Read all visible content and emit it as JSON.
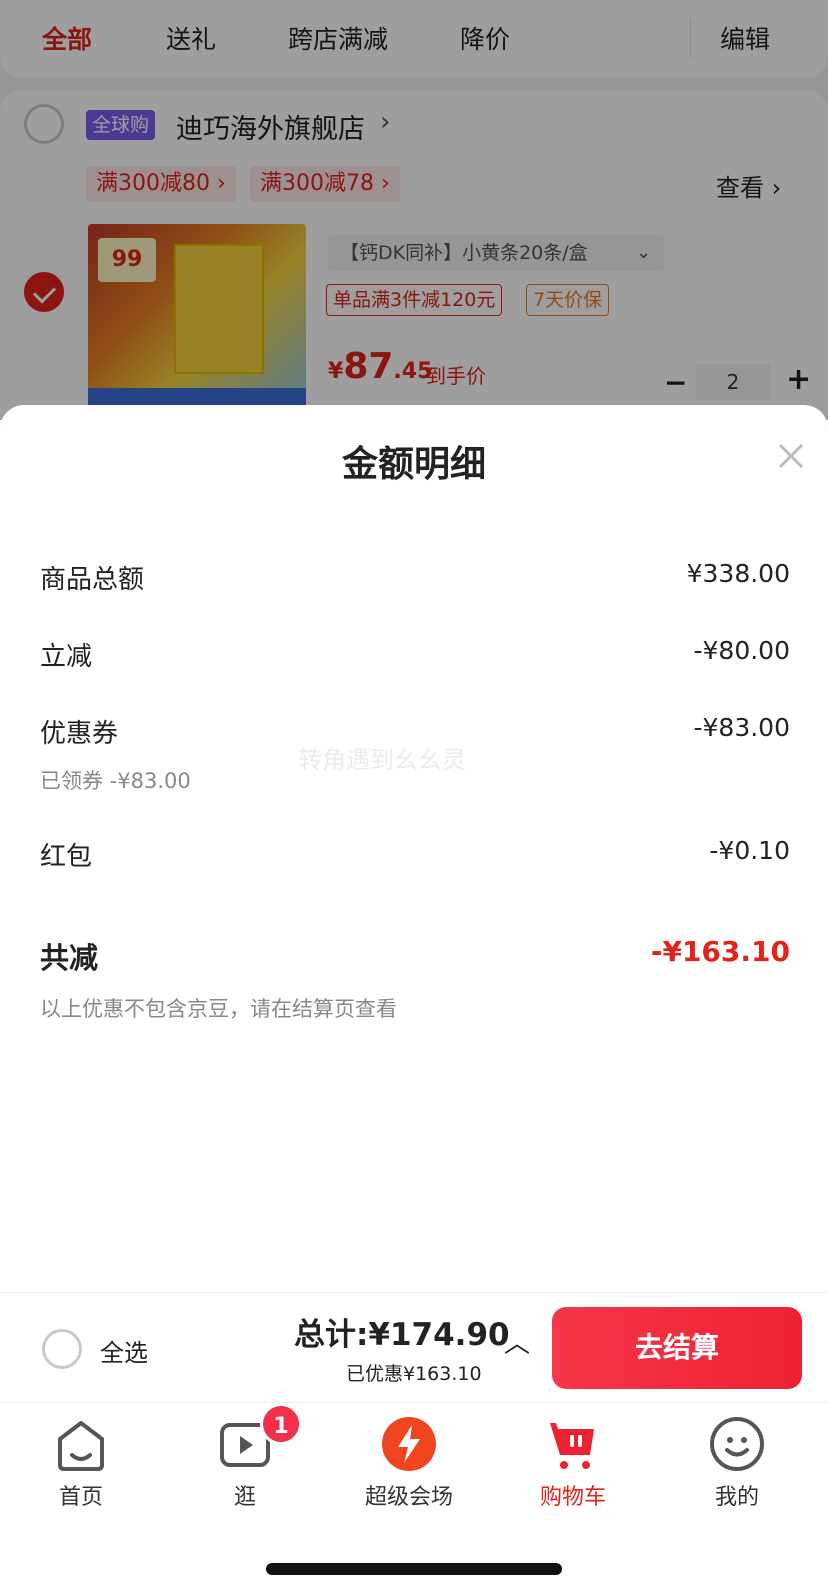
{
  "tabs": [
    {
      "label": "全部",
      "active": true
    },
    {
      "label": "送礼",
      "active": false
    },
    {
      "label": "跨店满减",
      "active": false
    },
    {
      "label": "降价",
      "active": false
    }
  ],
  "edit_label": "编辑",
  "store": {
    "badge": "全球购",
    "name": "迪巧海外旗舰店",
    "promos": [
      "满300减80 ›",
      "满300减78 ›"
    ],
    "view_label": "查看 ›"
  },
  "product": {
    "spec": "【钙DK同补】小黄条20条/盒",
    "tag_discount": "单品满3件减120元",
    "tag_guarantee": "7天价保",
    "price_currency": "¥",
    "price_int": "87",
    "price_dec": ".45",
    "price_note": "到手价",
    "quantity": "2",
    "image_price": "99"
  },
  "sheet": {
    "title": "金额明细",
    "rows": [
      {
        "label": "商品总额",
        "value": "¥338.00"
      },
      {
        "label": "立减",
        "value": "-¥80.00"
      },
      {
        "label": "优惠券",
        "value": "-¥83.00",
        "sub": "已领券 -¥83.00"
      },
      {
        "label": "红包",
        "value": "-¥0.10"
      }
    ],
    "total_label": "共减",
    "total_value": "-¥163.10",
    "note": "以上优惠不包含京豆，请在结算页查看",
    "watermark": "转角遇到幺幺灵"
  },
  "checkout": {
    "select_all": "全选",
    "total": "总计:¥174.90",
    "saved": "已优惠¥163.10",
    "button": "去结算"
  },
  "nav": [
    {
      "label": "首页",
      "icon": "home-icon"
    },
    {
      "label": "逛",
      "icon": "video-icon",
      "badge": "1"
    },
    {
      "label": "超级会场",
      "icon": "super-venue-icon"
    },
    {
      "label": "购物车",
      "icon": "cart-icon",
      "active": true
    },
    {
      "label": "我的",
      "icon": "profile-icon"
    }
  ],
  "colors": {
    "accent": "#e2231a",
    "badge_purple": "#7b5cf0"
  }
}
